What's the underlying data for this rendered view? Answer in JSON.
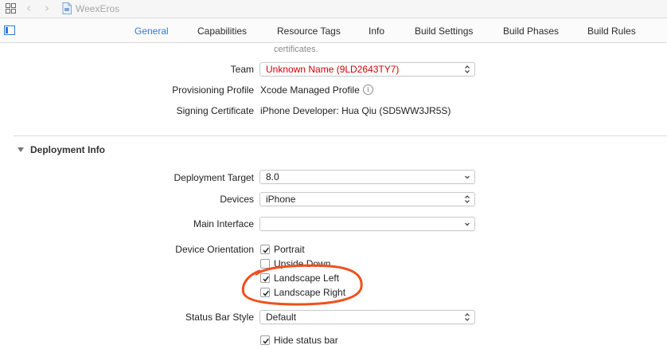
{
  "titlebar": {
    "breadcrumb": "WeexEros"
  },
  "tabs": [
    {
      "label": "General",
      "active": true
    },
    {
      "label": "Capabilities",
      "active": false
    },
    {
      "label": "Resource Tags",
      "active": false
    },
    {
      "label": "Info",
      "active": false
    },
    {
      "label": "Build Settings",
      "active": false
    },
    {
      "label": "Build Phases",
      "active": false
    },
    {
      "label": "Build Rules",
      "active": false
    }
  ],
  "signing": {
    "certificates_text": "certificates.",
    "team_label": "Team",
    "team_value": "Unknown Name (9LD2643TY7)",
    "profile_label": "Provisioning Profile",
    "profile_value": "Xcode Managed Profile",
    "info_glyph": "i",
    "certificate_label": "Signing Certificate",
    "certificate_value": "iPhone Developer: Hua Qiu (SD5WW3JR5S)"
  },
  "deployment": {
    "section_title": "Deployment Info",
    "target_label": "Deployment Target",
    "target_value": "8.0",
    "devices_label": "Devices",
    "devices_value": "iPhone",
    "main_interface_label": "Main Interface",
    "main_interface_value": "",
    "orientation_label": "Device Orientation",
    "orientations": [
      {
        "label": "Portrait",
        "checked": true
      },
      {
        "label": "Upside Down",
        "checked": false
      },
      {
        "label": "Landscape Left",
        "checked": true
      },
      {
        "label": "Landscape Right",
        "checked": true
      }
    ],
    "status_bar_label": "Status Bar Style",
    "status_bar_value": "Default",
    "hide_status_bar_label": "Hide status bar",
    "hide_status_bar_checked": true
  },
  "colors": {
    "active_tab": "#2f7bd8",
    "team_error": "#d40000",
    "annotation": "#f0501e"
  },
  "icons": [
    "grid-icon",
    "chevron-left-icon",
    "chevron-right-icon",
    "file-icon",
    "sidebar-toggle-icon",
    "info-icon",
    "disclosure-triangle-icon",
    "popup-chevron-icon",
    "checkmark-icon"
  ]
}
